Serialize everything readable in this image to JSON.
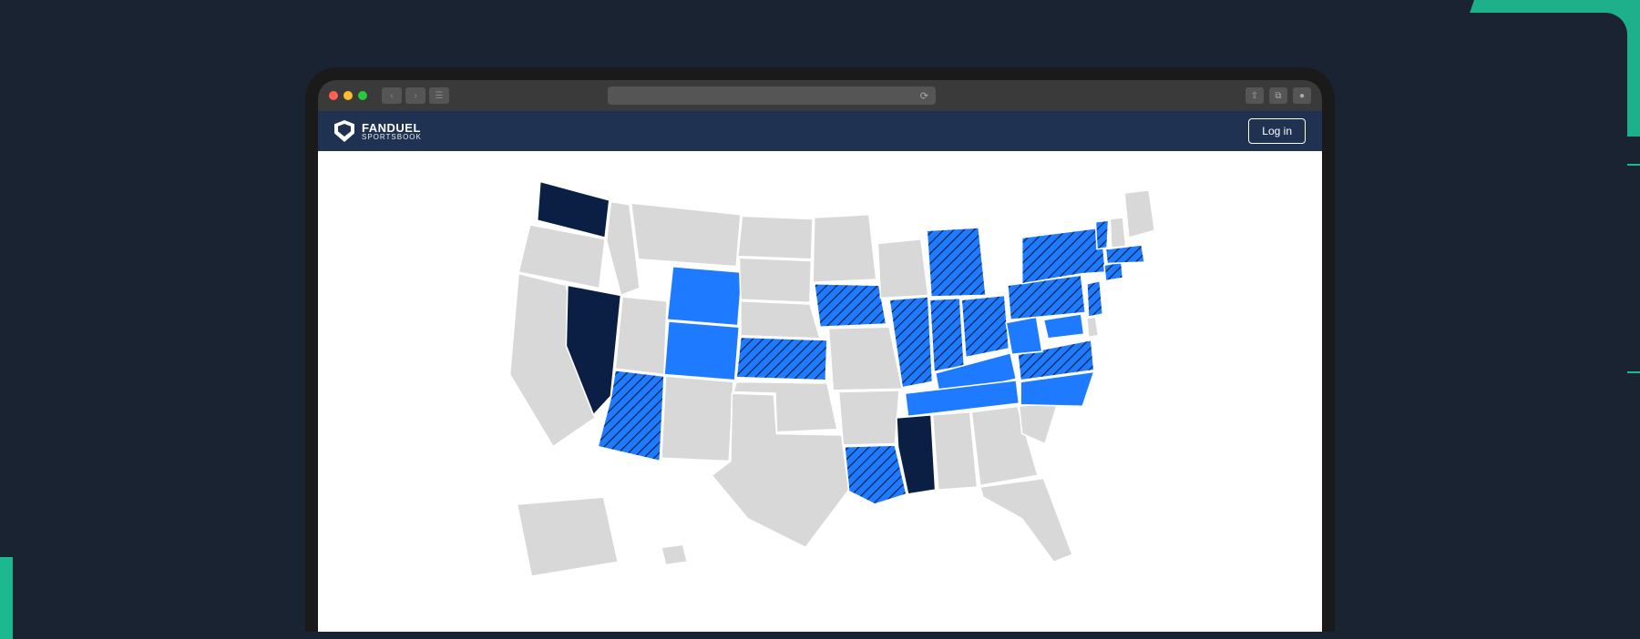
{
  "header": {
    "logo_main": "FANDUEL",
    "logo_sub": "SPORTSBOOK",
    "login_label": "Log in"
  },
  "map": {
    "states_dark": [
      "WA",
      "NV",
      "MS"
    ],
    "states_blue": [
      "CO",
      "WY",
      "KY",
      "TN",
      "NC",
      "WV",
      "MD"
    ],
    "states_hatched": [
      "AZ",
      "KS",
      "IA",
      "IL",
      "IN",
      "OH",
      "MI",
      "PA",
      "NY",
      "VA",
      "NJ",
      "CT",
      "MA",
      "VT",
      "LA"
    ]
  }
}
